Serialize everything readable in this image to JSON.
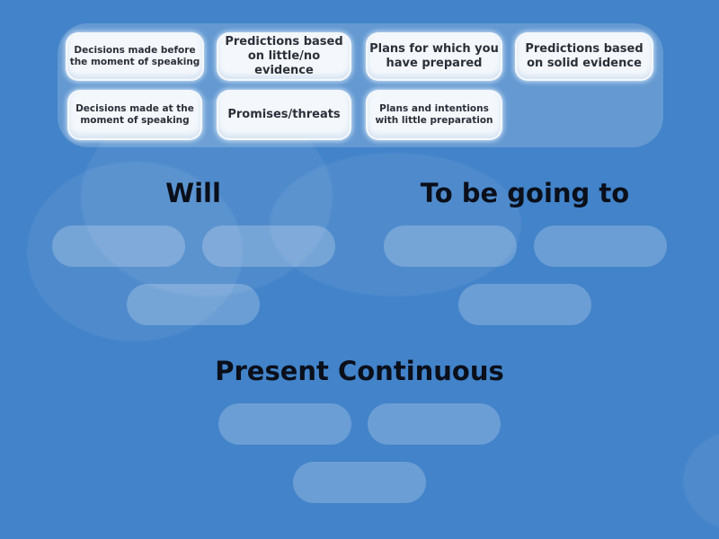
{
  "colors": {
    "background": "#4283c9",
    "card_background": "#f4f8fc",
    "card_text": "#2b2f38",
    "heading_text": "#0a0f1a"
  },
  "bank": {
    "cards": [
      {
        "id": "c1",
        "label": "Decisions made before the moment of speaking"
      },
      {
        "id": "c2",
        "label": "Predictions based on little/no evidence"
      },
      {
        "id": "c3",
        "label": "Plans for which you have prepared"
      },
      {
        "id": "c4",
        "label": "Predictions based on solid evidence"
      },
      {
        "id": "c5",
        "label": "Decisions made at the moment of speaking"
      },
      {
        "id": "c6",
        "label": "Promises/threats"
      },
      {
        "id": "c7",
        "label": "Plans and intentions with little preparation"
      }
    ]
  },
  "groups": [
    {
      "title": "Will",
      "slots": 3
    },
    {
      "title": "To be going to",
      "slots": 3
    },
    {
      "title": "Present Continuous",
      "slots": 3
    }
  ]
}
